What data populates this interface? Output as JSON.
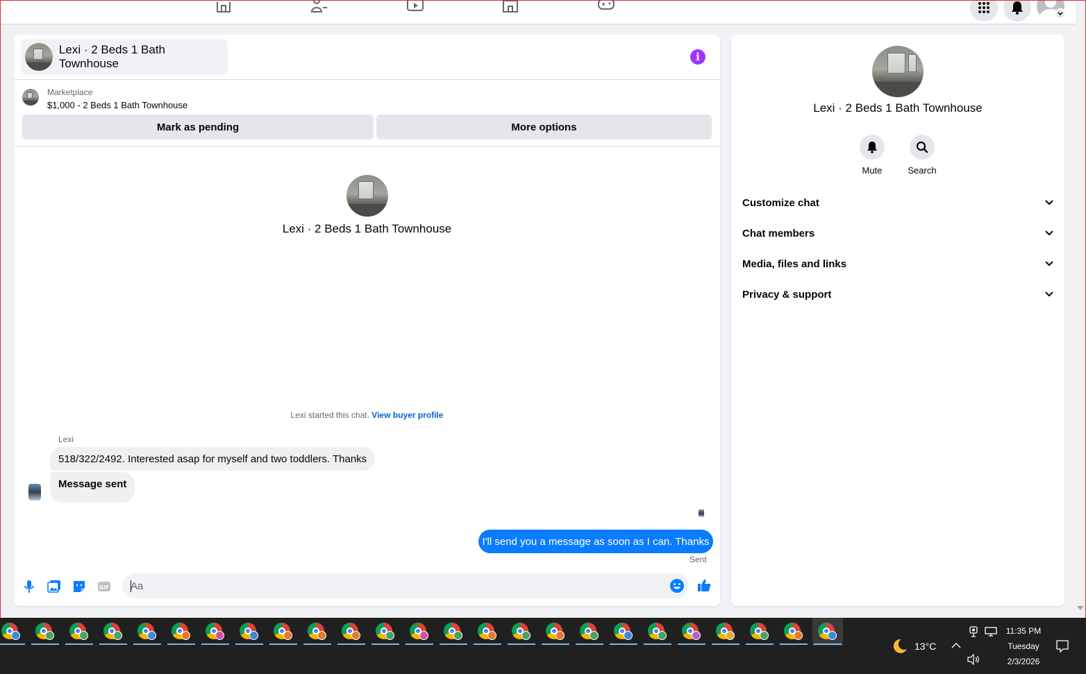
{
  "topbar": {
    "nav_icons": [
      "home-icon",
      "friends-icon",
      "video-icon",
      "marketplace-icon",
      "gaming-icon"
    ],
    "right_buttons": [
      "menu-grid-icon",
      "notifications-icon",
      "account-avatar"
    ]
  },
  "chat": {
    "title": "Lexi · 2 Beds 1 Bath Townhouse",
    "info_icon": "i",
    "marketplace_label": "Marketplace",
    "listing": "$1,000 - 2 Beds 1 Bath Townhouse",
    "mark_pending": "Mark as pending",
    "more_options": "More options",
    "center_title": "Lexi · 2 Beds 1 Bath Townhouse",
    "started_text": "Lexi started this chat. ",
    "view_profile": "View buyer profile",
    "sender": "Lexi",
    "messages_in": [
      "518/322/2492. Interested asap for myself and two toddlers. Thanks",
      "Message sent"
    ],
    "message_out": "I'll send you a message as soon as I can. Thanks",
    "sent_status": "Sent",
    "composer_placeholder": "Aa",
    "composer_icons": [
      "microphone-icon",
      "photo-icon",
      "sticker-icon",
      "gif-icon",
      "emoji-icon",
      "like-icon"
    ],
    "gif_label": "GIF"
  },
  "side": {
    "title": "Lexi · 2 Beds 1 Bath Townhouse",
    "mute": "Mute",
    "search": "Search",
    "sections": [
      "Customize chat",
      "Chat members",
      "Media, files and links",
      "Privacy & support"
    ]
  },
  "taskbar": {
    "temperature": "13°C",
    "time": "11:35 PM",
    "day": "Tuesday",
    "date": "2/3/2026",
    "badge_colors": [
      "#3b8ad9",
      "#4aa35c",
      "#4aa35c",
      "#4aa35c",
      "#3b8ad9",
      "#e37a2b",
      "#d64fa0",
      "#3b8ad9",
      "#e37a2b",
      "#e37a2b",
      "#e37a2b",
      "#4aa35c",
      "#d64fa0",
      "#4aa35c",
      "#e37a2b",
      "#4aa35c",
      "#e37a2b",
      "#4aa35c",
      "#3b8ad9",
      "#4aa35c",
      "#b05fd0",
      "#e0b030",
      "#4aa35c",
      "#e37a2b",
      "#3b8ad9"
    ]
  },
  "colors": {
    "accent_blue": "#0a7cff",
    "info_purple": "#a033ff",
    "link_blue": "#0064d1"
  }
}
